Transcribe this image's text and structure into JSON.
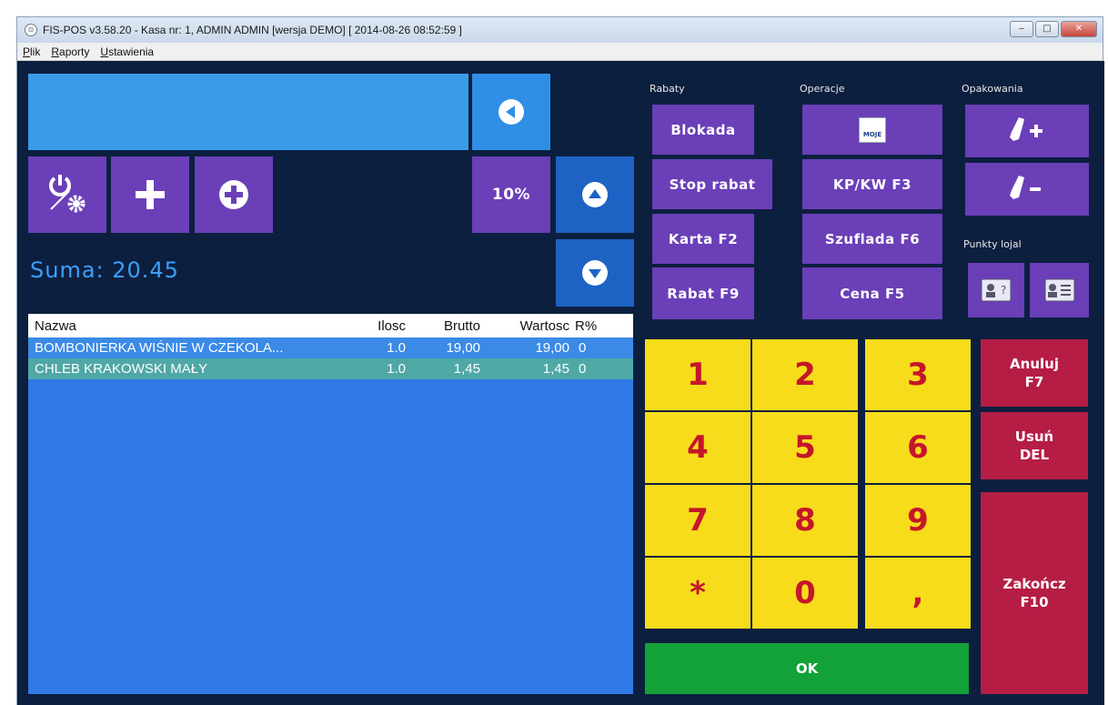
{
  "window": {
    "title": "FIS-POS v3.58.20 - Kasa nr: 1, ADMIN ADMIN [wersja DEMO]  [ 2014-08-26 08:52:59 ]",
    "controls": {
      "minimize": "‒",
      "maximize": "□",
      "close": "✕"
    }
  },
  "menu": [
    "Plik",
    "Raporty",
    "Ustawienia"
  ],
  "summary": {
    "suma": "Suma: 20.45"
  },
  "buttons": {
    "discount_percent": "10%"
  },
  "sections": {
    "rabaty": "Rabaty",
    "operacje": "Operacje",
    "opakowania": "Opakowania",
    "punkty": "Punkty lojal"
  },
  "actions": {
    "blokada": "Blokada",
    "stop_rabat": "Stop rabat",
    "karta": "Karta F2",
    "rabat": "Rabat F9",
    "moje_logo": "MOJE",
    "kpkw": "KP/KW F3",
    "szuflada": "Szuflada F6",
    "cena": "Cena F5"
  },
  "table": {
    "headers": [
      "Nazwa",
      "Ilosc",
      "Brutto",
      "Wartosc",
      "R%"
    ],
    "rows": [
      [
        "BOMBONIERKA WIŚNIE W CZEKOLA...",
        "1.0",
        "19,00",
        "19,00",
        "0"
      ],
      [
        "CHLEB KRAKOWSKI MAŁY",
        "1.0",
        "1,45",
        "1,45",
        "0"
      ]
    ]
  },
  "keypad": [
    "1",
    "2",
    "3",
    "4",
    "5",
    "6",
    "7",
    "8",
    "9",
    "*",
    "0",
    ","
  ],
  "side_buttons": {
    "anuluj": [
      "Anuluj",
      "F7"
    ],
    "usun": [
      "Usuń",
      "DEL"
    ],
    "zakoncz": [
      "Zakończ",
      "F10"
    ]
  },
  "ok_label": "OK",
  "colors": {
    "background": "#0c1f3f",
    "purple": "#6a3fb8",
    "blue": "#2f8fe6",
    "keypad": "#f7dc1b",
    "keypad_text": "#c6152b",
    "red": "#b51d45",
    "green": "#13a238"
  }
}
